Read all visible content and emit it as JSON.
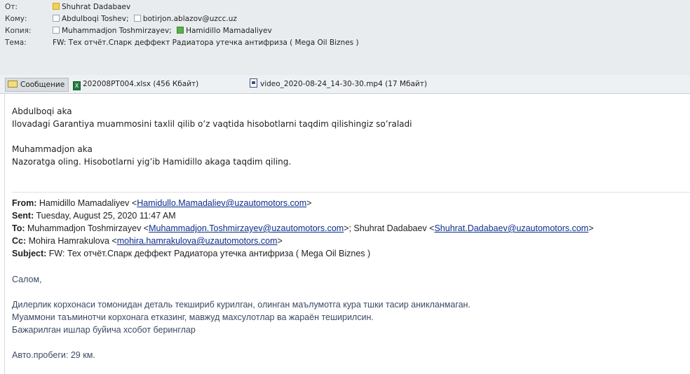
{
  "header": {
    "from_label": "От:",
    "from_value": "Shuhrat Dadabaev",
    "to_label": "Кому:",
    "to_recipients": [
      "Abdulboqi Toshev;",
      "botirjon.ablazov@uzcc.uz"
    ],
    "cc_label": "Копия:",
    "cc_recipients": [
      "Muhammadjon Toshmirzayev;",
      "Hamidillo Mamadaliyev"
    ],
    "subject_label": "Тема:",
    "subject_value": "FW: Тех отчёт.Спарк деффект Радиатора утечка антифриза ( Mega Oil Biznes )"
  },
  "tabs": {
    "message_label": "Сообщение",
    "attachments": [
      {
        "name": "202008PT004.xlsx (456 Кбайт)",
        "icon": "excel-file-icon"
      },
      {
        "name": "video_2020-08-24_14-30-30.mp4 (17 Мбайт)",
        "icon": "video-file-icon"
      }
    ]
  },
  "message": {
    "line1": "Abdulboqi aka",
    "line2": "Ilovadagi Garantiya muammosini taxlil qilib o’z vaqtida hisobotlarni taqdim qilishingiz so’raladi",
    "line3": "Muhammadjon aka",
    "line4": "Nazoratga oling. Hisobotlarni yig’ib Hamidillo akaga taqdim qiling."
  },
  "forwarded": {
    "from_key": "From:",
    "from_name": "Hamidillo Mamadaliyev <",
    "from_email": "Hamidullo.Mamadaliev@uzautomotors.com",
    "from_close": ">",
    "sent_key": "Sent:",
    "sent_value": "Tuesday, August 25, 2020 11:47 AM",
    "to_key": "To:",
    "to_name1": "Muhammadjon Toshmirzayev <",
    "to_email1": "Muhammadjon.Toshmirzayev@uzautomotors.com",
    "to_mid": ">; Shuhrat Dadabaev <",
    "to_email2": "Shuhrat.Dadabaev@uzautomotors.com",
    "to_close": ">",
    "cc_key": "Cc:",
    "cc_name": "Mohira Hamrakulova <",
    "cc_email": "mohira.hamrakulova@uzautomotors.com",
    "cc_close": ">",
    "subject_key": "Subject:",
    "subject_value": "FW: Тех отчёт.Спарк деффект Радиатора утечка антифриза ( Mega Oil Biznes )"
  },
  "forwarded_body": {
    "greeting": "Салом,",
    "p1": "Дилерлик корхонаси томонидан деталь текшириб курилган, олинган маълумотга кура тшки тасир аникланмаган.",
    "p2": "Муаммони таъминотчи корхонага етказинг, мавжуд махсулотлар ва жараён теширилсин.",
    "p3": "Бажарилган ишлар буйича хсобот беринглар",
    "mileage": "Авто.пробеги: 29 км."
  }
}
